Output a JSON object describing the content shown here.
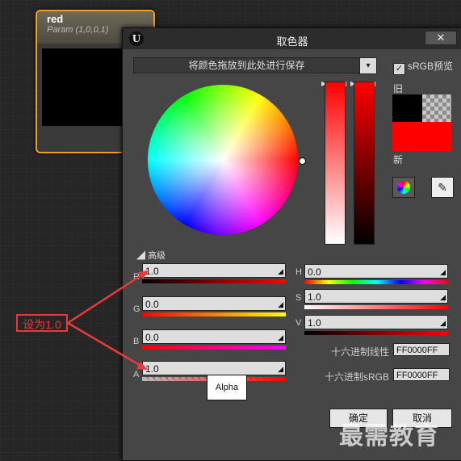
{
  "node": {
    "title": "red",
    "subtitle": "Param (1,0,0,1)"
  },
  "dialog": {
    "title": "取色器",
    "close_label": "✕",
    "logo_text": "U",
    "dropzone_text": "将颜色拖放到此处进行保存",
    "dropdown_label": "▾",
    "srgb_label": "sRGB预览",
    "srgb_checked": true,
    "old_label": "旧",
    "new_label": "新",
    "new_color": "#ff0000",
    "advanced_label": "高级",
    "rgba": [
      {
        "label": "R",
        "value": "1.0"
      },
      {
        "label": "G",
        "value": "0.0"
      },
      {
        "label": "B",
        "value": "0.0"
      },
      {
        "label": "A",
        "value": "1.0"
      }
    ],
    "hsv": [
      {
        "label": "H",
        "value": "0.0"
      },
      {
        "label": "S",
        "value": "1.0"
      },
      {
        "label": "V",
        "value": "1.0"
      }
    ],
    "hex_linear_label": "十六进制线性",
    "hex_linear_value": "FF0000FF",
    "hex_srgb_label": "十六进制sRGB",
    "hex_srgb_value": "FF0000FF",
    "tooltip": "Alpha",
    "ok_label": "确定",
    "cancel_label": "取消"
  },
  "annotation": {
    "text": "设为1.0",
    "color": "#e83a3a"
  },
  "watermark": "最需教育",
  "colors": {
    "node_border": "#f0a020",
    "dialog_bg": "#464646",
    "titlebar": "#2c2c2c"
  }
}
